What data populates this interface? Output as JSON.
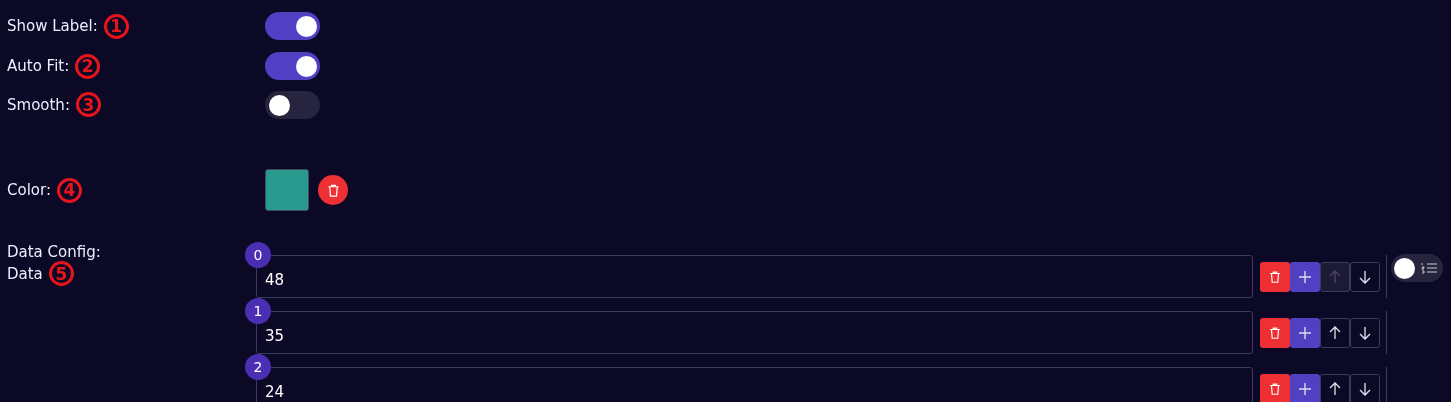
{
  "toggles": [
    {
      "label": "Show Label:",
      "marker": "1",
      "on": true
    },
    {
      "label": "Auto Fit:",
      "marker": "2",
      "on": true
    },
    {
      "label": "Smooth:",
      "marker": "3",
      "on": false
    }
  ],
  "color": {
    "label": "Color:",
    "marker": "4",
    "color": "#2a9a8f"
  },
  "data_config": {
    "label": "Data Config:"
  },
  "data": {
    "label": "Data",
    "marker": "5",
    "list_mode": false,
    "items": [
      {
        "index": "0",
        "value": "48",
        "up_disabled": true,
        "down_disabled": false
      },
      {
        "index": "1",
        "value": "35",
        "up_disabled": false,
        "down_disabled": false
      },
      {
        "index": "2",
        "value": "24",
        "up_disabled": false,
        "down_disabled": false
      }
    ]
  }
}
